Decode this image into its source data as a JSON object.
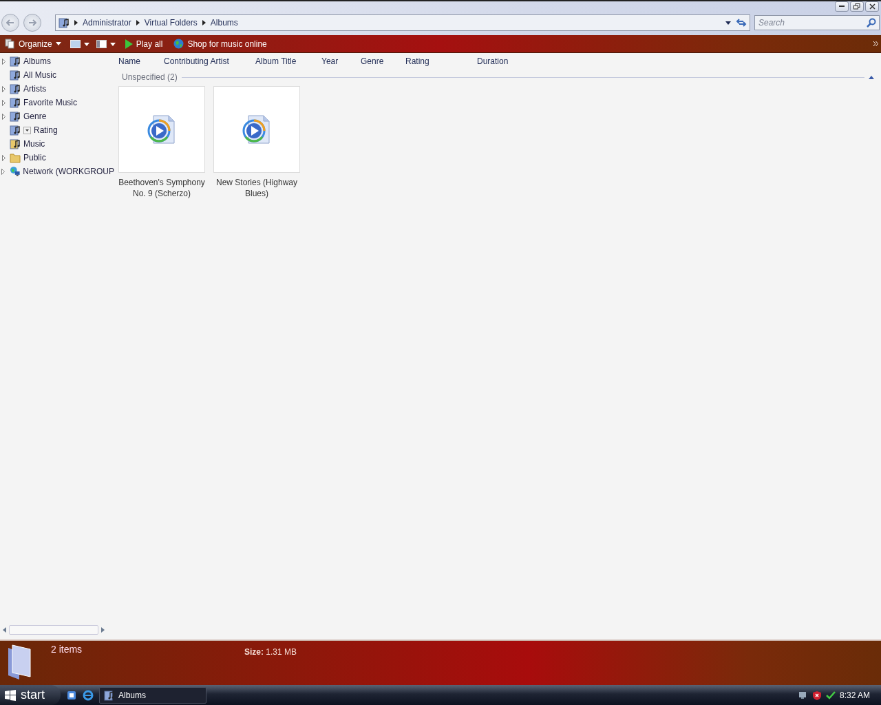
{
  "address": {
    "crumbs": [
      "Administrator",
      "Virtual Folders",
      "Albums"
    ]
  },
  "search": {
    "placeholder": "Search"
  },
  "toolbar": {
    "items": [
      {
        "kind": "organize",
        "label": "Organize"
      },
      {
        "kind": "play",
        "label": "Play all"
      },
      {
        "kind": "shop",
        "label": "Shop for music online"
      }
    ]
  },
  "sidebar": {
    "items": [
      {
        "kind": "music",
        "label": "Albums",
        "expandable": true
      },
      {
        "kind": "music",
        "label": "All Music",
        "expandable": false
      },
      {
        "kind": "music",
        "label": "Artists",
        "expandable": true
      },
      {
        "kind": "music",
        "label": "Favorite Music",
        "expandable": true
      },
      {
        "kind": "music",
        "label": "Genre",
        "expandable": true
      },
      {
        "kind": "music-filter",
        "label": "Rating",
        "expandable": false
      },
      {
        "kind": "music-folder",
        "label": "Music",
        "expandable": false
      },
      {
        "kind": "folder",
        "label": "Public",
        "expandable": true
      },
      {
        "kind": "network",
        "label": "Network (WORKGROUP",
        "expandable": true
      }
    ]
  },
  "columns": [
    "Name",
    "Contributing Artist",
    "Album Title",
    "Year",
    "Genre",
    "Rating",
    "Duration"
  ],
  "group": {
    "label": "Unspecified (2)",
    "expanded": true
  },
  "files": [
    {
      "name": "Beethoven's Symphony No. 9 (Scherzo)"
    },
    {
      "name": "New Stories (Highway Blues)"
    }
  ],
  "details": {
    "count": "2 items",
    "size_label": "Size:",
    "size_value": "1.31 MB"
  },
  "taskbar": {
    "start": "start",
    "windows": [
      {
        "label": "Albums"
      }
    ],
    "clock": "8:32 AM"
  }
}
